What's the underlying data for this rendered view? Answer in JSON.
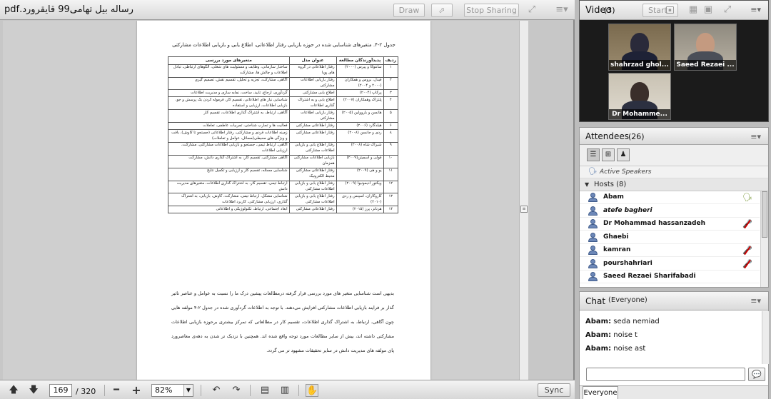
{
  "share": {
    "title": "رساله بیل تهامی99 قایقرورد.pdf",
    "draw_label": "Draw",
    "stop_sharing_label": "Stop Sharing",
    "page_current": "169",
    "page_total": "/ 320",
    "zoom": "82%",
    "sync_label": "Sync",
    "icons": [
      "pointer-icon",
      "fullscreen-icon",
      "pod-menu-icon",
      "arrow-up-icon",
      "arrow-down-icon",
      "zoom-out-icon",
      "zoom-in-icon",
      "rotate-left-icon",
      "rotate-right-icon",
      "single-page-icon",
      "two-page-icon",
      "hand-tool-icon"
    ]
  },
  "doc": {
    "caption": "جدول ۲-۴. متغیرهای شناسایی شده در حوزه بازیابی رفتار اطلاعاتی، اطلاع یابی و بازیابی اطلاعات مشارکتی",
    "headers": [
      "ردیف",
      "پدیدآورندگان مطالعه",
      "عنوان مدل",
      "متغیرهای مورد بررسی"
    ],
    "rows": [
      [
        "۱",
        "سانتوکا و پیرس (۲۰۰۰)",
        "رفتار اطلاعاتی در گروه های پویا",
        "ساختار سازمانی، وظایف و مسئولیت های شغلی، الگوهای ارتباطی، تبادل اطلاعات و چالش ها، مشارکت"
      ],
      [
        "۲",
        "فیدل، بروس و همکاران (۲۰۰۰ و ۲۰۰۴)",
        "رفتار بازیابی اطلاعات مشارکتی",
        "آگاهی، مشارکت، تجزیه و تحلیل، تقسیم نقش، تصمیم گیری"
      ],
      [
        "۳",
        "پرکاپ (۲۰۰۴)",
        "اطلاع یابی مشارکتی",
        "گردآوری، ارجاع، تایید، ساخت، نمایه سازی و مدیریت اطلاعات"
      ],
      [
        "۴",
        "پلتزاک وهمکاران (۲۰۰۷)",
        "اطلاع یابی و به اشتراک گذاری اطلاعات",
        "شناسایی نیاز های اطلاعاتی، تقسیم کار، فرموله کردن یک پرسش و جو، بازیابی اطلاعات، ارزیابی و استفاده"
      ],
      [
        "۵",
        "هانسن و یاروولین (۲۰۰۵)",
        "رفتار بازیابی اطلاعات مشارکتی",
        "آگاهی، ارتباط، به اشتراک گذاری اطلاعات، تقسیم کار"
      ],
      [
        "۶",
        "هیلدگارد (۲۰۰۶)",
        "رفتار اطلاعاتی مشارکتی",
        "فعالیت ها و تجارب شناختی، تجربیات عاطفی، تعاملات"
      ],
      [
        "۸",
        "ردی و جانسن (۲۰۰۸)",
        "رفتار اطلاعاتی مشارکتی",
        "زمینه اطلاعات فردی و مشارکتی، رفتار اطلاعاتی (جستجو تا کاوش)، بافت و ویژگی های محیطی(مسائل، عوامل و تعاملات)"
      ],
      [
        "۹",
        "شیراک شاه (۲۰۰۸)",
        "رفتار اطلاع یابی و بازیابی اطلاعات مشارکتی",
        "آگاهی، ارتباط تیمی، جستجو و بازیابی اطلاعات مشارکتی، مشارکت، ارزیابی اطلاعات"
      ],
      [
        "۱۰",
        "فولی و اسمیتن(۲۰۰۹)",
        "بازیابی اطلاعات مشارکتی همزمان",
        "آگاهی مشارکتی، تقسیم کار، به اشتراک گذاری دانش، مشارکت"
      ],
      [
        "۱۱",
        "یو و هی (۲۰۰۹)",
        "رفتار اطلاعاتی مشارکتی محیط الکترونیک",
        "شناسایی مسئله، تقسیم کار و ارزیابی و تکمیل نتایج"
      ],
      [
        "۱۲",
        "ویکتور ادیمونیوا (۲۰۰۹)",
        "رفتار اطلاع یابی و بازیابی اطلاعات مشارکتی",
        "ارتباط تیمی، تقسیم کار، به اشتراک گذاری اطلاعات، متغیرهای مدیریت دانش"
      ],
      [
        "۱۳",
        "کاروکاران، اسپنس و ردی (۲۰۱۰)",
        "رفتار اطلاع یابی و بازیابی اطلاعات مشارکتی",
        "شناسایی مشکل، ارتباط تیمی، مشارکت، کاوش، بازیابی، به اشتراک گذاری، ارزیابی مشارکتی، کاربرد اطلاعات"
      ],
      [
        "۱۴",
        "هرنانز، پرز (۲۰۱۵)",
        "رفتار اطلاعاتی مشارکتی",
        "ابعاد اجتماعی، ارتباط، تکنولوژیکی و اطلاعاتی"
      ]
    ],
    "paragraph": "بدیهی است شناسایی متغیر های مورد بررسی قرار گرفته درمطالعات پیشین درک ما را نسبت به عوامل و عناصر تاثیر گذار بر فرایند بازیابی اطلاعات مشارکتی افزایش می‌دهند. با توجه به اطلاعات گردآوری شده در جدول ۲-۴ مولفه هایی چون آگاهی، ارتباط، به اشتراک گذاری اطلاعات، تقسیم کار در مطالعاتی که تمرکز بیشتری برحوزه بازیابی اطلاعات مشارکتی داشته اند، بیش از سایر مطالعات مورد توجه واقع شده اند. همچنین با نزدیک تر شدن به دهه‌ی معاصرورد پای مولفه های مدیریت دانش در سایر تحقیقات مشهود تر می گردد."
  },
  "video": {
    "title": "Video",
    "count": "(3)",
    "start_label": "Start",
    "tiles": [
      {
        "name": "shahrzad ghol..."
      },
      {
        "name": "Saeed Rezaei ..."
      },
      {
        "name": "Dr Mohamme..."
      }
    ]
  },
  "attendees": {
    "title": "Attendees",
    "count": "(26)",
    "active_speakers": "Active Speakers",
    "hosts_label": "Hosts (8)",
    "rows": [
      {
        "name": "Abam",
        "italic": false,
        "mic": "speaker"
      },
      {
        "name": "atefe bagheri",
        "italic": true,
        "mic": ""
      },
      {
        "name": "Dr Mohammad hassanzadeh",
        "italic": false,
        "mic": "muted"
      },
      {
        "name": "Ghaebi",
        "italic": false,
        "mic": ""
      },
      {
        "name": "kamran",
        "italic": false,
        "mic": "muted"
      },
      {
        "name": "pourshahriari",
        "italic": false,
        "mic": "muted"
      },
      {
        "name": "Saeed Rezaei Sharifabadi",
        "italic": false,
        "mic": ""
      }
    ]
  },
  "chat": {
    "title": "Chat",
    "scope": "(Everyone)",
    "tab_label": "Everyone",
    "messages": [
      {
        "sender": "Abam:",
        "text": "seda nemiad"
      },
      {
        "sender": "Abam:",
        "text": "noise t"
      },
      {
        "sender": "Abam:",
        "text": "noise ast"
      }
    ]
  }
}
